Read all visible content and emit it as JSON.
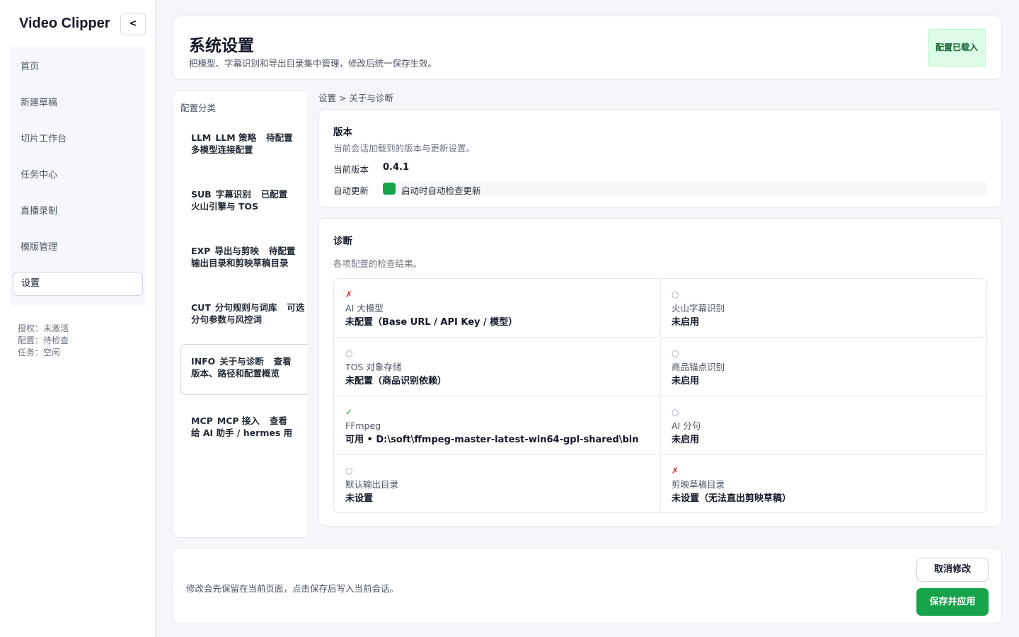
{
  "sidebar": {
    "brand": "Video Clipper",
    "collapse_label": "<",
    "items": [
      {
        "label": "首页"
      },
      {
        "label": "新建草稿"
      },
      {
        "label": "切片工作台"
      },
      {
        "label": "任务中心"
      },
      {
        "label": "直播录制"
      },
      {
        "label": "模版管理"
      },
      {
        "label": "设置",
        "active": true
      }
    ],
    "status": {
      "license": "授权：未激活",
      "config": "配置：待检查",
      "task": "任务：空闲"
    }
  },
  "header": {
    "title": "系统设置",
    "subtitle": "把模型、字幕识别和导出目录集中管理，修改后统一保存生效。",
    "badge": "配置已载入",
    "badge_color": "#dcfce7"
  },
  "categories": {
    "heading": "配置分类",
    "items": [
      {
        "code": "LLM",
        "name": "LLM 策略",
        "status": "待配置",
        "desc": "多模型连接配置"
      },
      {
        "code": "SUB",
        "name": "字幕识别",
        "status": "已配置",
        "desc": "火山引擎与 TOS"
      },
      {
        "code": "EXP",
        "name": "导出与剪映",
        "status": "待配置",
        "desc": "输出目录和剪映草稿目录"
      },
      {
        "code": "CUT",
        "name": "分句规则与词库",
        "status": "可选",
        "desc": "分句参数与风控词"
      },
      {
        "code": "INFO",
        "name": "关于与诊断",
        "status": "查看",
        "desc": "版本、路径和配置概览",
        "active": true
      },
      {
        "code": "MCP",
        "name": "MCP 接入",
        "status": "查看",
        "desc": "给 AI 助手 / hermes 用"
      }
    ]
  },
  "breadcrumb": "设置 > 关于与诊断",
  "version": {
    "title": "版本",
    "desc": "当前会话加载到的版本与更新设置。",
    "current_label": "当前版本",
    "current_value": "0.4.1",
    "auto_update_label": "自动更新",
    "auto_update_text": "启动时自动检查更新",
    "auto_update_on": true,
    "accent": "#16a34a"
  },
  "diagnostics": {
    "title": "诊断",
    "desc": "各项配置的检查结果。",
    "items": [
      {
        "icon": "✗",
        "state": "fail",
        "name": "AI 大模型",
        "value": "未配置（Base URL / API Key / 模型）"
      },
      {
        "icon": "○",
        "state": "idle",
        "name": "火山字幕识别",
        "value": "未启用"
      },
      {
        "icon": "○",
        "state": "idle",
        "name": "TOS 对象存储",
        "value": "未配置（商品识别依赖）"
      },
      {
        "icon": "○",
        "state": "idle",
        "name": "商品锚点识别",
        "value": "未启用"
      },
      {
        "icon": "✓",
        "state": "ok",
        "name": "FFmpeg",
        "value": "可用 • D:\\soft\\ffmpeg-master-latest-win64-gpl-shared\\bin"
      },
      {
        "icon": "○",
        "state": "idle",
        "name": "AI 分句",
        "value": "未启用"
      },
      {
        "icon": "○",
        "state": "idle",
        "name": "默认输出目录",
        "value": "未设置"
      },
      {
        "icon": "✗",
        "state": "fail",
        "name": "剪映草稿目录",
        "value": "未设置（无法直出剪映草稿）"
      }
    ]
  },
  "footer": {
    "note": "修改会先保留在当前页面，点击保存后写入当前会话。",
    "cancel_label": "取消修改",
    "save_label": "保存并应用"
  }
}
